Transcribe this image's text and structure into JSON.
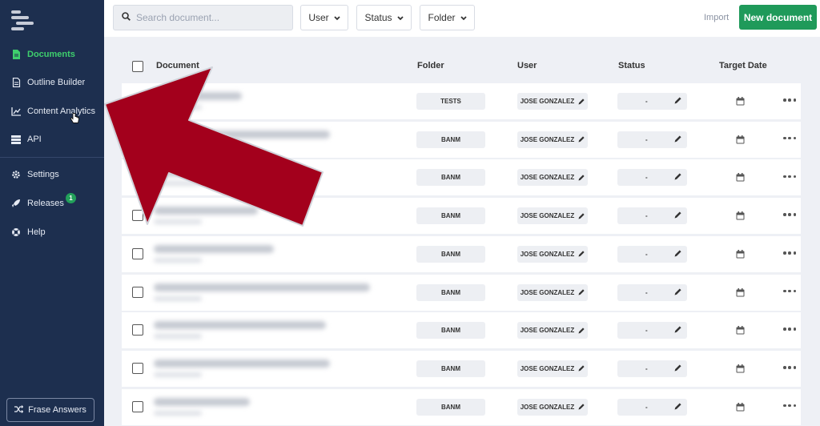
{
  "sidebar": {
    "items": [
      {
        "label": "Documents",
        "icon": "document-icon",
        "active": true
      },
      {
        "label": "Outline Builder",
        "icon": "outline-doc-icon",
        "active": false
      },
      {
        "label": "Content Analytics",
        "icon": "chart-icon",
        "active": false
      },
      {
        "label": "API",
        "icon": "server-icon",
        "active": false
      },
      {
        "label": "Settings",
        "icon": "gear-icon",
        "active": false
      },
      {
        "label": "Releases",
        "icon": "rocket-icon",
        "active": false
      },
      {
        "label": "Help",
        "icon": "lifebuoy-icon",
        "active": false
      }
    ],
    "releases_badge": "1",
    "answers_button": "Frase Answers"
  },
  "toolbar": {
    "search_placeholder": "Search document...",
    "filters": [
      "User",
      "Status",
      "Folder"
    ],
    "import_label": "Import",
    "new_document_label": "New document"
  },
  "table": {
    "headers": [
      "Document",
      "Folder",
      "User",
      "Status",
      "Target Date"
    ],
    "rows": [
      {
        "folder": "TESTS",
        "user": "JOSE GONZALEZ",
        "status": "-"
      },
      {
        "folder": "BANM",
        "user": "JOSE GONZALEZ",
        "status": "-"
      },
      {
        "folder": "BANM",
        "user": "JOSE GONZALEZ",
        "status": "-"
      },
      {
        "folder": "BANM",
        "user": "JOSE GONZALEZ",
        "status": "-"
      },
      {
        "folder": "BANM",
        "user": "JOSE GONZALEZ",
        "status": "-"
      },
      {
        "folder": "BANM",
        "user": "JOSE GONZALEZ",
        "status": "-"
      },
      {
        "folder": "BANM",
        "user": "JOSE GONZALEZ",
        "status": "-"
      },
      {
        "folder": "BANM",
        "user": "JOSE GONZALEZ",
        "status": "-"
      },
      {
        "folder": "BANM",
        "user": "JOSE GONZALEZ",
        "status": "-"
      }
    ]
  },
  "colors": {
    "sidebar_bg": "#1d2f4f",
    "active_nav": "#3ecf6d",
    "primary_button": "#1f9a5a",
    "arrow": "#a3001c"
  }
}
